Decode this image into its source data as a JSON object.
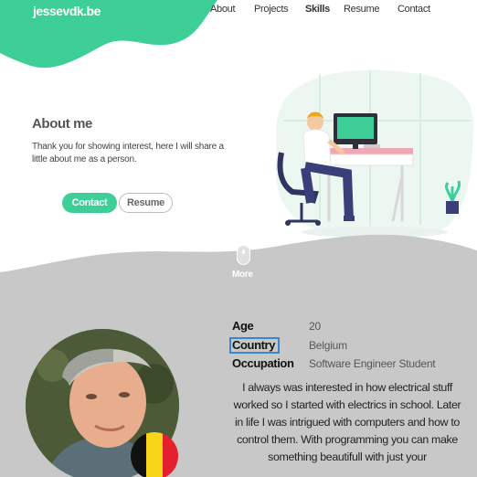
{
  "brand": {
    "logo": "jessevdk.be",
    "accent": "#3ecf99"
  },
  "nav": {
    "items": [
      "About",
      "Projects",
      "Skills",
      "Resume",
      "Contact"
    ],
    "active": "Skills"
  },
  "hero": {
    "title": "About me",
    "text": "Thank you for showing interest, here I will share a little about me as a person.",
    "contact_label": "Contact",
    "resume_label": "Resume"
  },
  "scroll": {
    "more_label": "More"
  },
  "info": {
    "age_label": "Age",
    "age_value": "20",
    "country_label": "Country",
    "country_value": "Belgium",
    "occupation_label": "Occupation",
    "occupation_value": "Software Engineer Student"
  },
  "bio": "I always was interested in how electrical stuff worked so I started with electrics in school. Later in life I was intrigued with computers and how to control them. With programming you can make something beautifull with just your",
  "colors": {
    "grey_section": "#c8c8c8",
    "flag": [
      "#111111",
      "#f7d417",
      "#e5202e"
    ]
  }
}
